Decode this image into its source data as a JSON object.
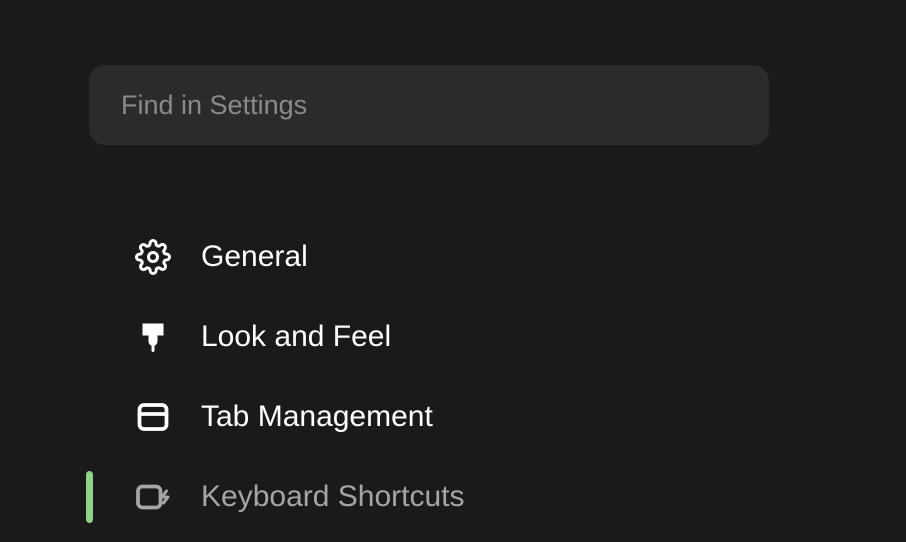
{
  "search": {
    "placeholder": "Find in Settings"
  },
  "nav": {
    "items": [
      {
        "label": "General",
        "active": false
      },
      {
        "label": "Look and Feel",
        "active": false
      },
      {
        "label": "Tab Management",
        "active": false
      },
      {
        "label": "Keyboard Shortcuts",
        "active": true
      }
    ]
  }
}
